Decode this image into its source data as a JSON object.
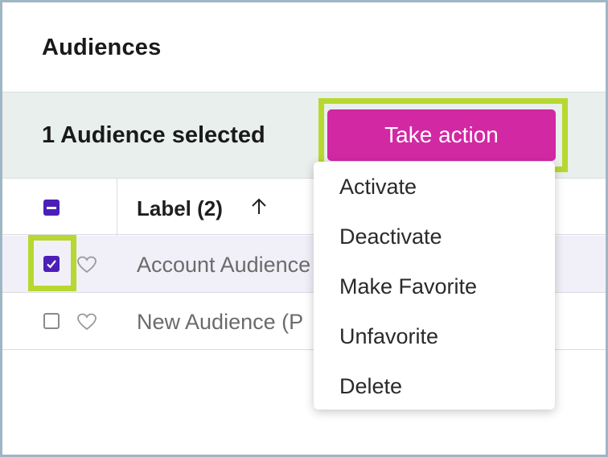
{
  "page": {
    "title": "Audiences"
  },
  "selection": {
    "text": "1 Audience selected",
    "take_action_label": "Take action"
  },
  "table": {
    "columns": [
      {
        "label": "Label (2)",
        "sort": "ascending",
        "sort_icon": "arrow-up-icon"
      }
    ],
    "rows": [
      {
        "label": "Account Audience (P",
        "checked": true,
        "favorite": false
      },
      {
        "label": "New Audience (P",
        "checked": false,
        "favorite": false
      }
    ],
    "select_all_state": "indeterminate"
  },
  "action_menu": {
    "items": [
      "Activate",
      "Deactivate",
      "Make Favorite",
      "Unfavorite",
      "Delete"
    ]
  },
  "colors": {
    "accent_button": "#d228a3",
    "checkbox": "#4b1fb8",
    "highlight": "#b7d830",
    "selection_bar": "#e9efec"
  }
}
